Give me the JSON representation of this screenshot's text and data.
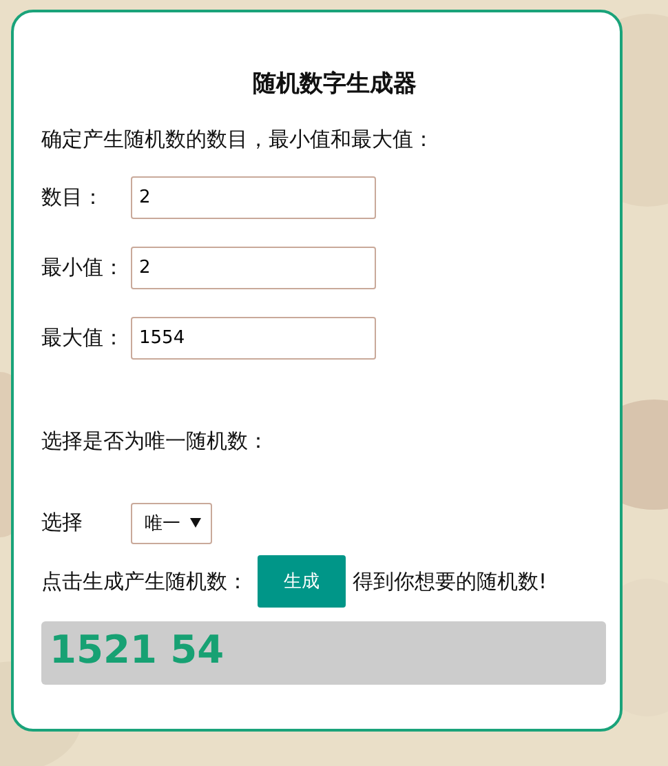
{
  "title": "随机数字生成器",
  "intro": "确定产生随机数的数目，最小值和最大值：",
  "fields": [
    {
      "label": "数目：",
      "value": "2"
    },
    {
      "label": "最小值：",
      "value": "2"
    },
    {
      "label": "最大值：",
      "value": "1554"
    }
  ],
  "unique_prompt": "选择是否为唯一随机数：",
  "select": {
    "label": "选择",
    "value": "唯一"
  },
  "generate": {
    "prompt": "点击生成产生随机数：",
    "button": "生成",
    "after": "得到你想要的随机数!"
  },
  "result": "1521 54"
}
